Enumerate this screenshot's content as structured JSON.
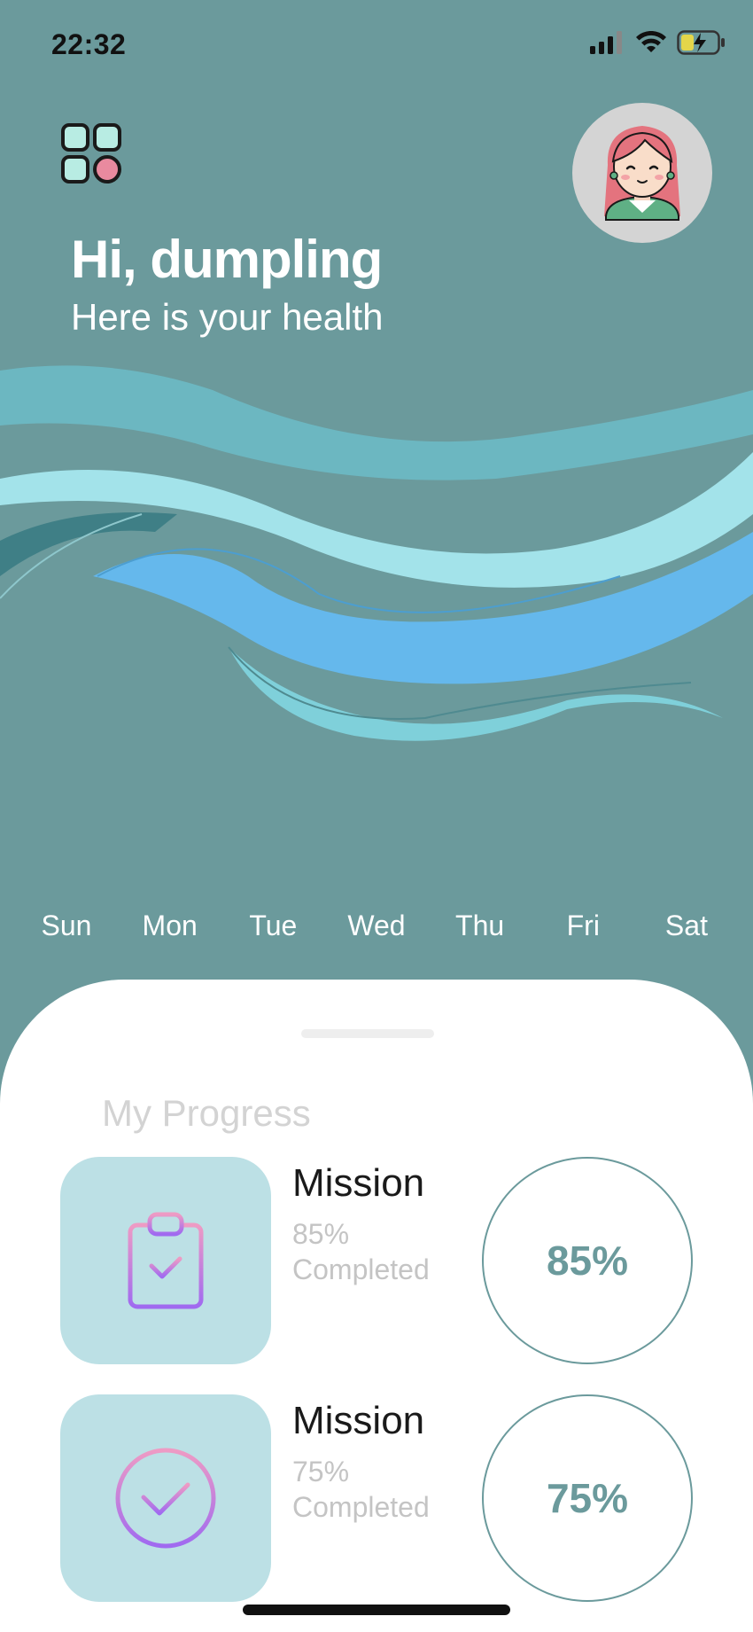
{
  "status_bar": {
    "time": "22:32"
  },
  "header": {
    "greeting": "Hi, dumpling",
    "subtitle": "Here is your health",
    "menu_icon": "grid-menu-icon",
    "avatar_icon": "user-avatar-icon"
  },
  "days": [
    "Sun",
    "Mon",
    "Tue",
    "Wed",
    "Thu",
    "Fri",
    "Sat"
  ],
  "progress": {
    "title": "My Progress",
    "items": [
      {
        "title": "Mission",
        "percent_text": "85%",
        "status": "Completed",
        "ring_label": "85%",
        "value": 85,
        "icon": "clipboard-check-icon"
      },
      {
        "title": "Mission",
        "percent_text": "75%",
        "status": "Completed",
        "ring_label": "75%",
        "value": 75,
        "icon": "check-circle-icon"
      }
    ]
  },
  "colors": {
    "background": "#6b9a9c",
    "card": "#bce0e5",
    "accent": "#6b9a9c",
    "wave_light": "#a3e3ea",
    "wave_blue": "#65b8ec",
    "wave_teal": "#6cb7c1"
  }
}
